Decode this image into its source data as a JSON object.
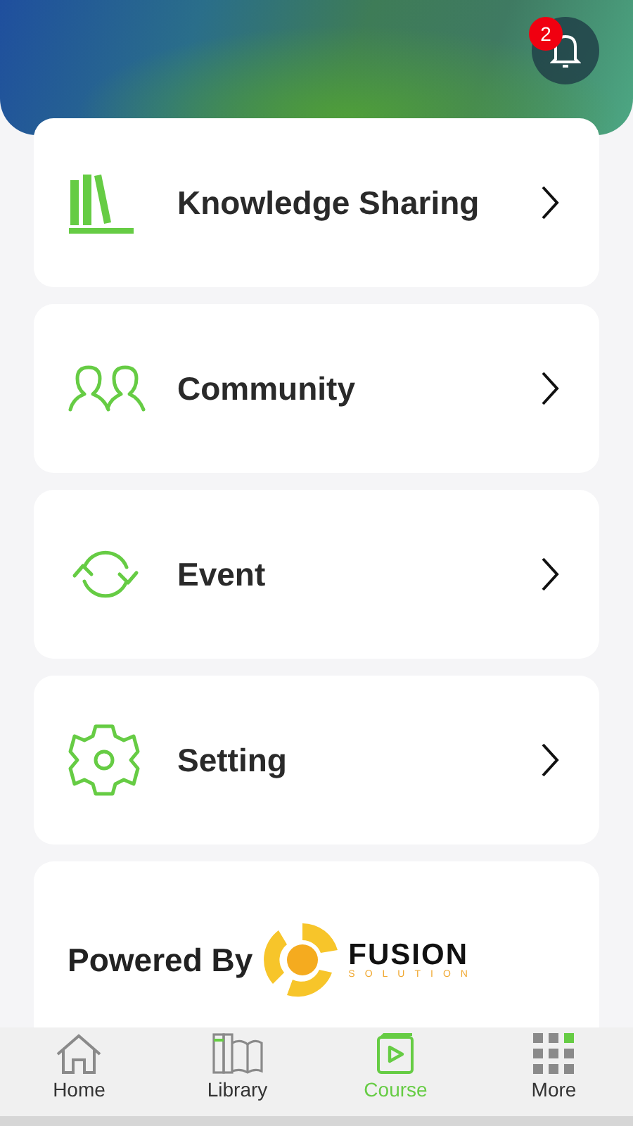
{
  "notifications": {
    "count": "2"
  },
  "menu": [
    {
      "label": "Knowledge Sharing",
      "kind": "books"
    },
    {
      "label": "Community",
      "kind": "people"
    },
    {
      "label": "Event",
      "kind": "sync"
    },
    {
      "label": "Setting",
      "kind": "gear"
    }
  ],
  "footer": {
    "label": "Powered By",
    "logo_name": "FUSION",
    "logo_tagline": "SOLUTION"
  },
  "tabs": [
    {
      "label": "Home",
      "kind": "home",
      "selected": false
    },
    {
      "label": "Library",
      "kind": "library",
      "selected": false
    },
    {
      "label": "Course",
      "kind": "course",
      "selected": true
    },
    {
      "label": "More",
      "kind": "more",
      "selected": false
    }
  ]
}
